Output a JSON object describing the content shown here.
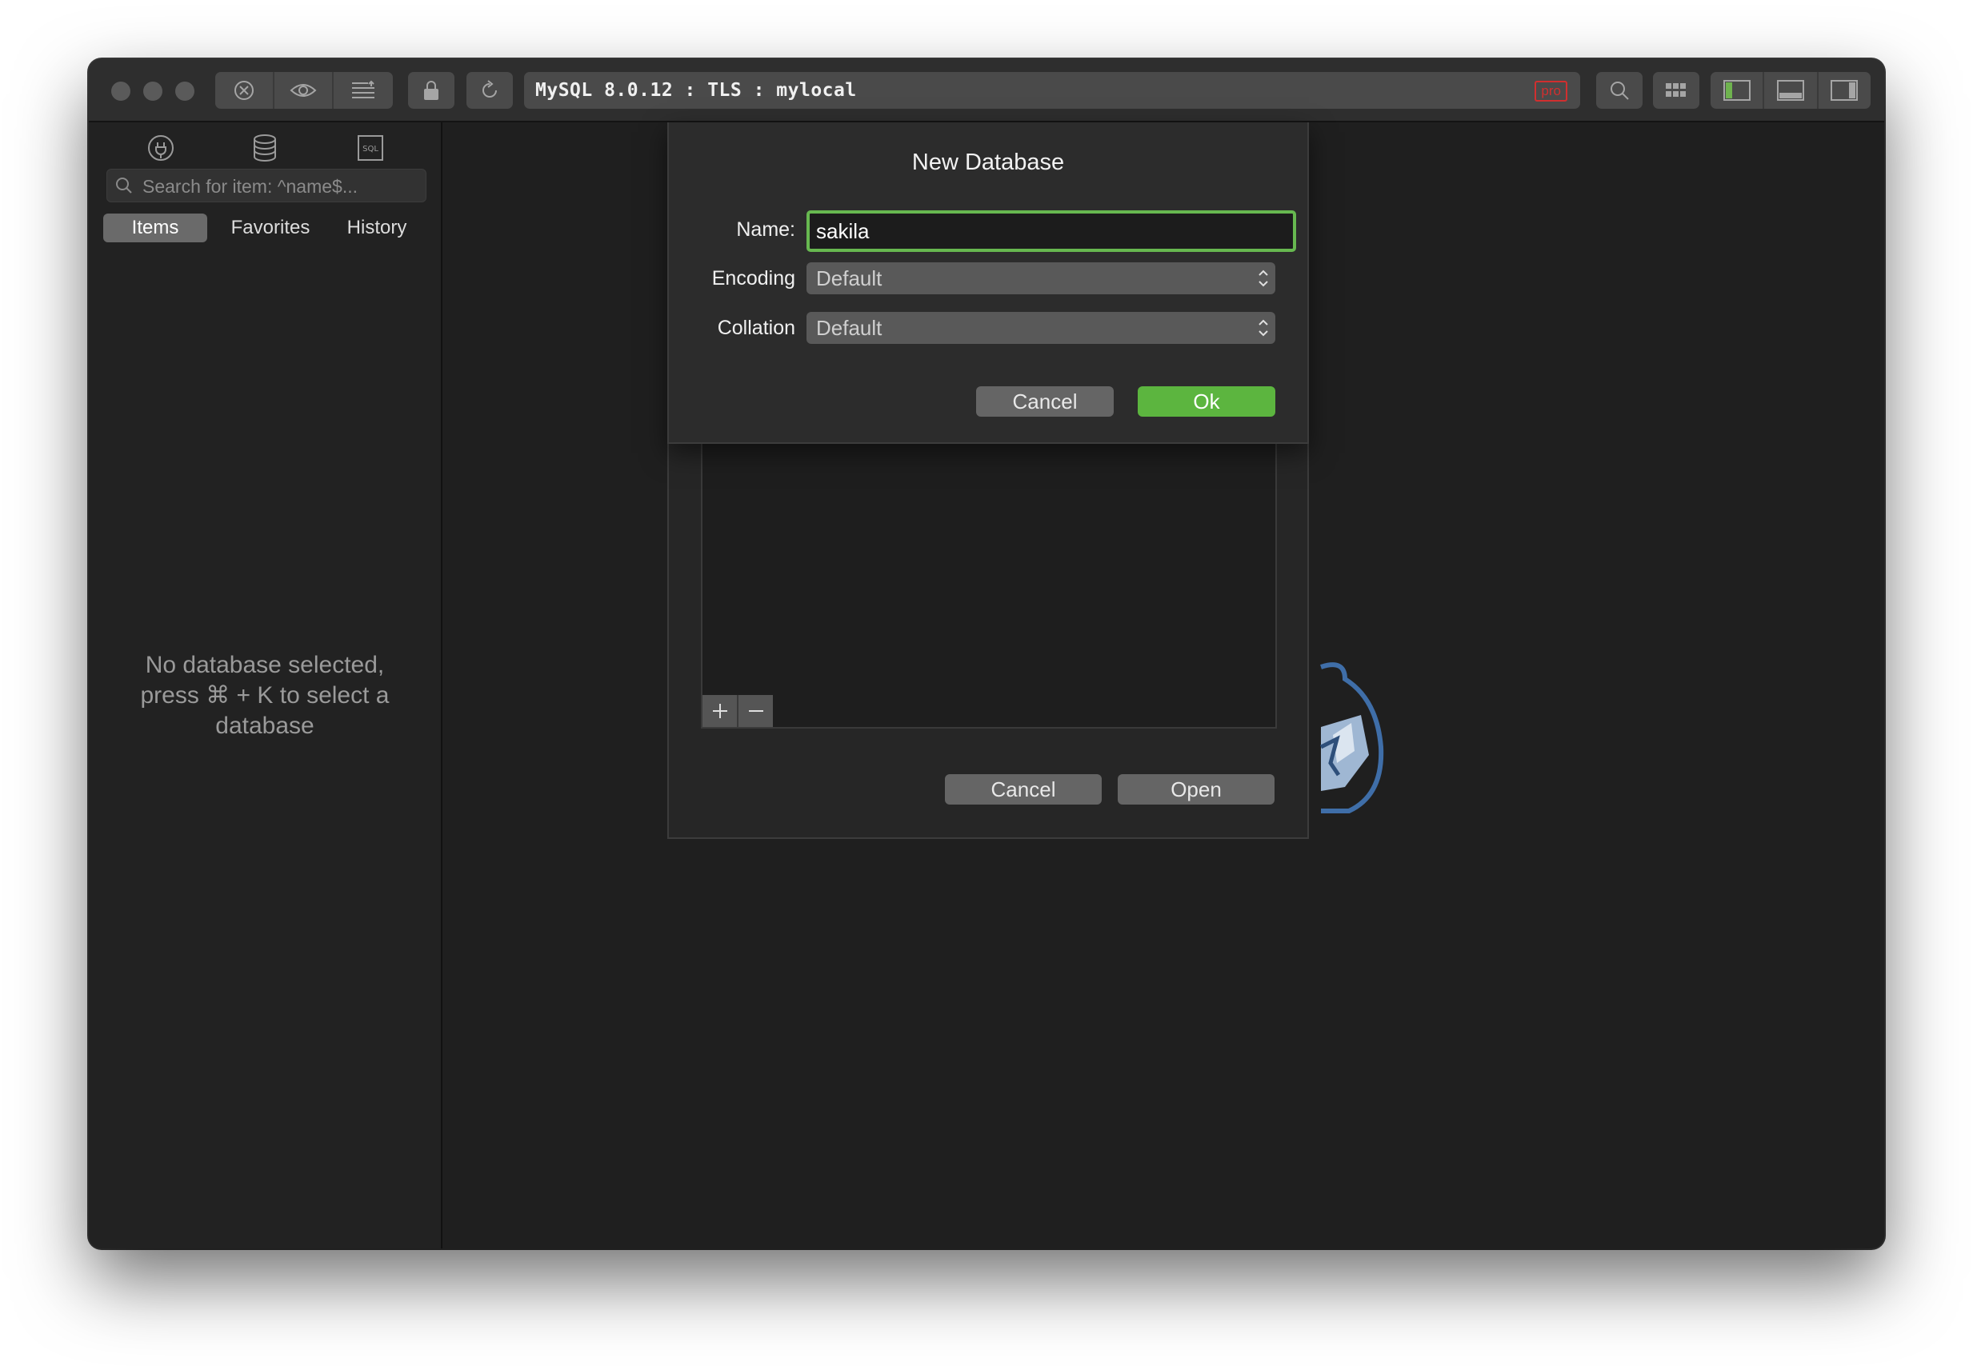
{
  "toolbar": {
    "connection_label": "MySQL 8.0.12 : TLS : mylocal",
    "badge": "pro"
  },
  "sidebar": {
    "search_placeholder": "Search for item: ^name$...",
    "tabs": [
      "Items",
      "Favorites",
      "History"
    ],
    "active_tab": "Items",
    "empty_message": [
      "No database selected,",
      "press ⌘ + K to select a",
      "database"
    ]
  },
  "dialog": {
    "title": "New Database",
    "name_label": "Name:",
    "name_value": "sakila",
    "encoding_label": "Encoding",
    "encoding_value": "Default",
    "collation_label": "Collation",
    "collation_value": "Default",
    "cancel_label": "Cancel",
    "ok_label": "Ok"
  },
  "open_sheet": {
    "cancel_label": "Cancel",
    "open_label": "Open"
  },
  "colors": {
    "accent_green": "#5cb53f",
    "focus_ring": "#67b850",
    "pro_badge": "#d12f2f"
  }
}
